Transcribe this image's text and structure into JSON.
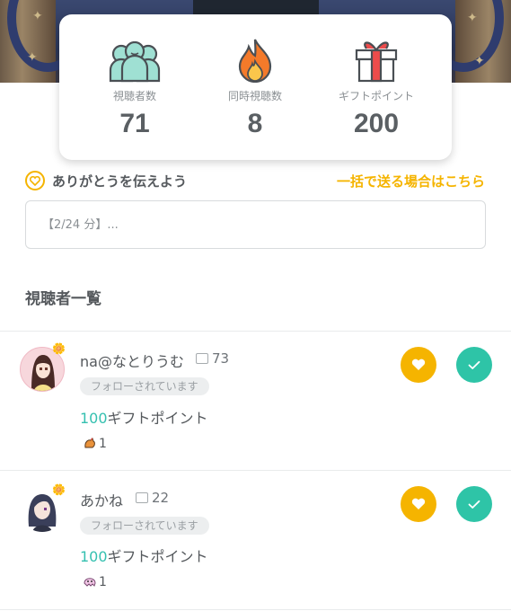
{
  "stats": [
    {
      "icon": "viewers-icon",
      "label": "視聴者数",
      "value": "71"
    },
    {
      "icon": "fire-icon",
      "label": "同時視聴数",
      "value": "8"
    },
    {
      "icon": "gift-icon",
      "label": "ギフトポイント",
      "value": "200"
    }
  ],
  "thanks": {
    "title": "ありがとうを伝えよう",
    "bulk_link": "一括で送る場合はこちら",
    "input_placeholder": "【2/24 分】..."
  },
  "viewer_list": {
    "title": "視聴者一覧",
    "viewers": [
      {
        "name": "na@なとりうむ",
        "comments": "73",
        "follow_label": "フォローされています",
        "gift_points": "100",
        "gift_suffix": "ギフトポイント",
        "item_count": "1"
      },
      {
        "name": "あかね",
        "comments": "22",
        "follow_label": "フォローされています",
        "gift_points": "100",
        "gift_suffix": "ギフトポイント",
        "item_count": "1"
      }
    ]
  },
  "colors": {
    "accent_yellow": "#f5b400",
    "accent_teal": "#2ec4a7",
    "points_teal": "#35c0b0",
    "text_dark": "#55595d"
  }
}
